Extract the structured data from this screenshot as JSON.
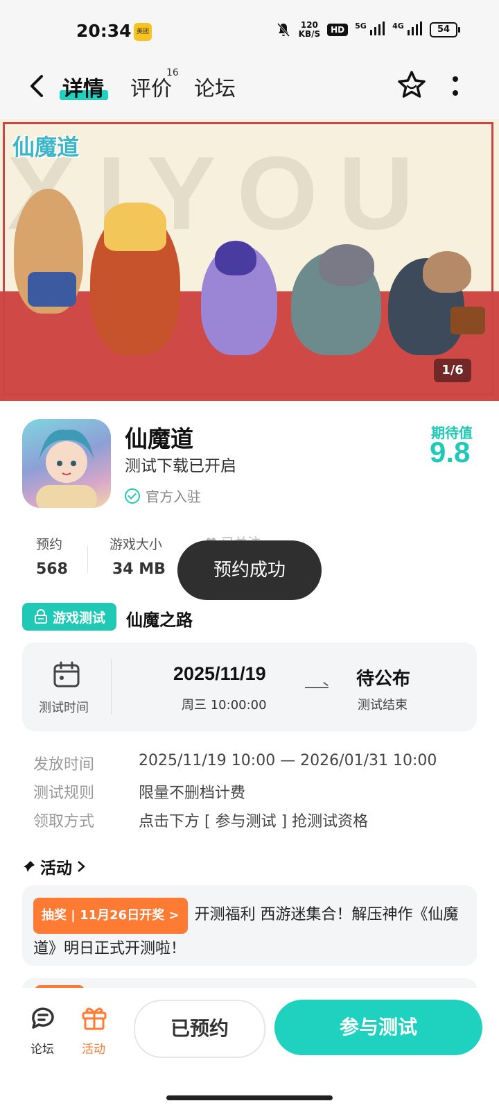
{
  "status_bar": {
    "time": "20:34",
    "app_badge": "美团",
    "net_speed_top": "120",
    "net_speed_unit": "KB/S",
    "hd_badge": "HD",
    "signal1": "5G",
    "signal2": "4G",
    "battery": "54"
  },
  "nav": {
    "tabs": [
      {
        "label": "详情"
      },
      {
        "label": "评价"
      },
      {
        "label": "论坛"
      }
    ],
    "review_count": "16"
  },
  "banner": {
    "bg_text": "XIYOU",
    "logo_text": "仙魔道",
    "counter": "1/6"
  },
  "app": {
    "name": "仙魔道",
    "subtitle": "测试下载已开启",
    "official": "官方入驻",
    "expect_label": "期待值",
    "expect_value": "9.8"
  },
  "stats": {
    "reservations_label": "预约",
    "reservations_value": "568",
    "size_label": "游戏大小",
    "size_value": "34 MB",
    "followed_label": "已关注"
  },
  "toast": "预约成功",
  "test": {
    "tag": "游戏测试",
    "name": "仙魔之路",
    "time_label": "测试时间",
    "start_date": "2025/11/19",
    "start_time": "周三  10:00:00",
    "end_title": "待公布",
    "end_sub": "测试结束",
    "rows": [
      {
        "key": "发放时间",
        "value": "2025/11/19 10:00 — 2026/01/31 10:00"
      },
      {
        "key": "测试规则",
        "value": "限量不删档计费"
      },
      {
        "key": "领取方式",
        "value": "点击下方 [ 参与测试 ] 抢测试资格"
      }
    ]
  },
  "activity": {
    "title": "活动",
    "badge": "抽奖 | 11月26日开奖 >",
    "text": "开测福利 西游迷集合！解压神作《仙魔道》明日正式开测啦！"
  },
  "bottom": {
    "forum_label": "论坛",
    "activity_label": "活动",
    "reserved_label": "已预约",
    "join_label": "参与测试",
    "accent": "#1fd2c0",
    "activity_color": "#ff7a33"
  }
}
